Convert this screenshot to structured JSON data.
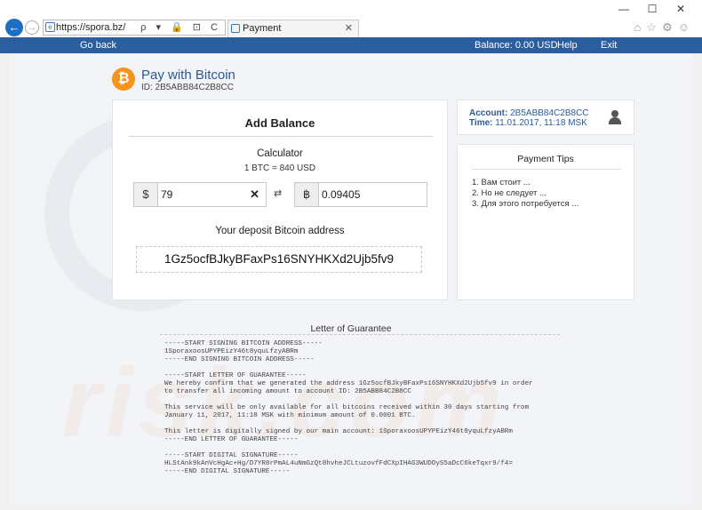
{
  "browser": {
    "address_url": "https://spora.bz/",
    "address_tools": "ρ ▾ 🔒 ⊡ C",
    "tab_title": "Payment",
    "window_controls": {
      "minimize": "—",
      "maximize": "☐",
      "close": "✕"
    }
  },
  "site_nav": {
    "back_label": "Go back",
    "balance": "Balance: 0.00 USD",
    "help": "Help",
    "exit": "Exit"
  },
  "brand": {
    "logo_symbol": "₿",
    "title": "Pay with Bitcoin",
    "id": "ID: 2B5ABB84C2B8CC"
  },
  "add_balance": {
    "title": "Add Balance",
    "calculator_title": "Calculator",
    "rate": "1 BTC = 840 USD",
    "usd_symbol": "$",
    "usd_value": "79",
    "clear_symbol": "✕",
    "swap_symbol": "⇄",
    "btc_symbol": "฿",
    "btc_value": "0.09405",
    "deposit_label": "Your deposit Bitcoin address",
    "deposit_address": "1Gz5ocfBJkyBFaxPs16SNYHKXd2Ujb5fv9"
  },
  "account": {
    "account_label": "Account:",
    "account_value": "2B5ABB84C2B8CC",
    "time_label": "Time:",
    "time_value": "11.01.2017, 11:18 MSK"
  },
  "tips": {
    "title": "Payment Tips",
    "items": [
      "1. Вам стоит ...",
      "2. Но не следует ...",
      "3. Для этого потребуется ..."
    ]
  },
  "guarantee": {
    "title": "Letter of Guarantee",
    "lines": [
      "-----START SIGNING BITCOIN ADDRESS-----",
      "1SporaxoosUPYPEizY46t8yquLfzyABRm",
      "-----END SIGNING BITCOIN ADDRESS-----",
      "",
      "-----START LETTER OF GUARANTEE-----",
      "We hereby confirm that we generated the address 1Gz5ocfBJkyBFaxPs16SNYHKXd2Ujb5fv9 in order",
      "to transfer all incoming amount to account ID: 2B5ABB84C2B8CC",
      "",
      "This service will be only available for all bitcoins received within 30 days starting from",
      "January 11, 2017, 11:18 MSK with minimum amount of 0.0001 BTC.",
      "",
      "This letter is digitally signed by our main account: 1SporaxoosUPYPEizY46t8yquLfzyABRm",
      "-----END LETTER OF GUARANTEE-----",
      "",
      "-----START DIGITAL SIGNATURE-----",
      "HLStAnk9kAnVcHgAc+Hg/D7YR8rPmAL4uNmGzQt8hvheJCLtuzovfFdCXpIHAG3WUDOyS5aDcC6keTqxr9/f4=",
      "-----END DIGITAL SIGNATURE-----"
    ]
  },
  "watermark": "risk.com"
}
